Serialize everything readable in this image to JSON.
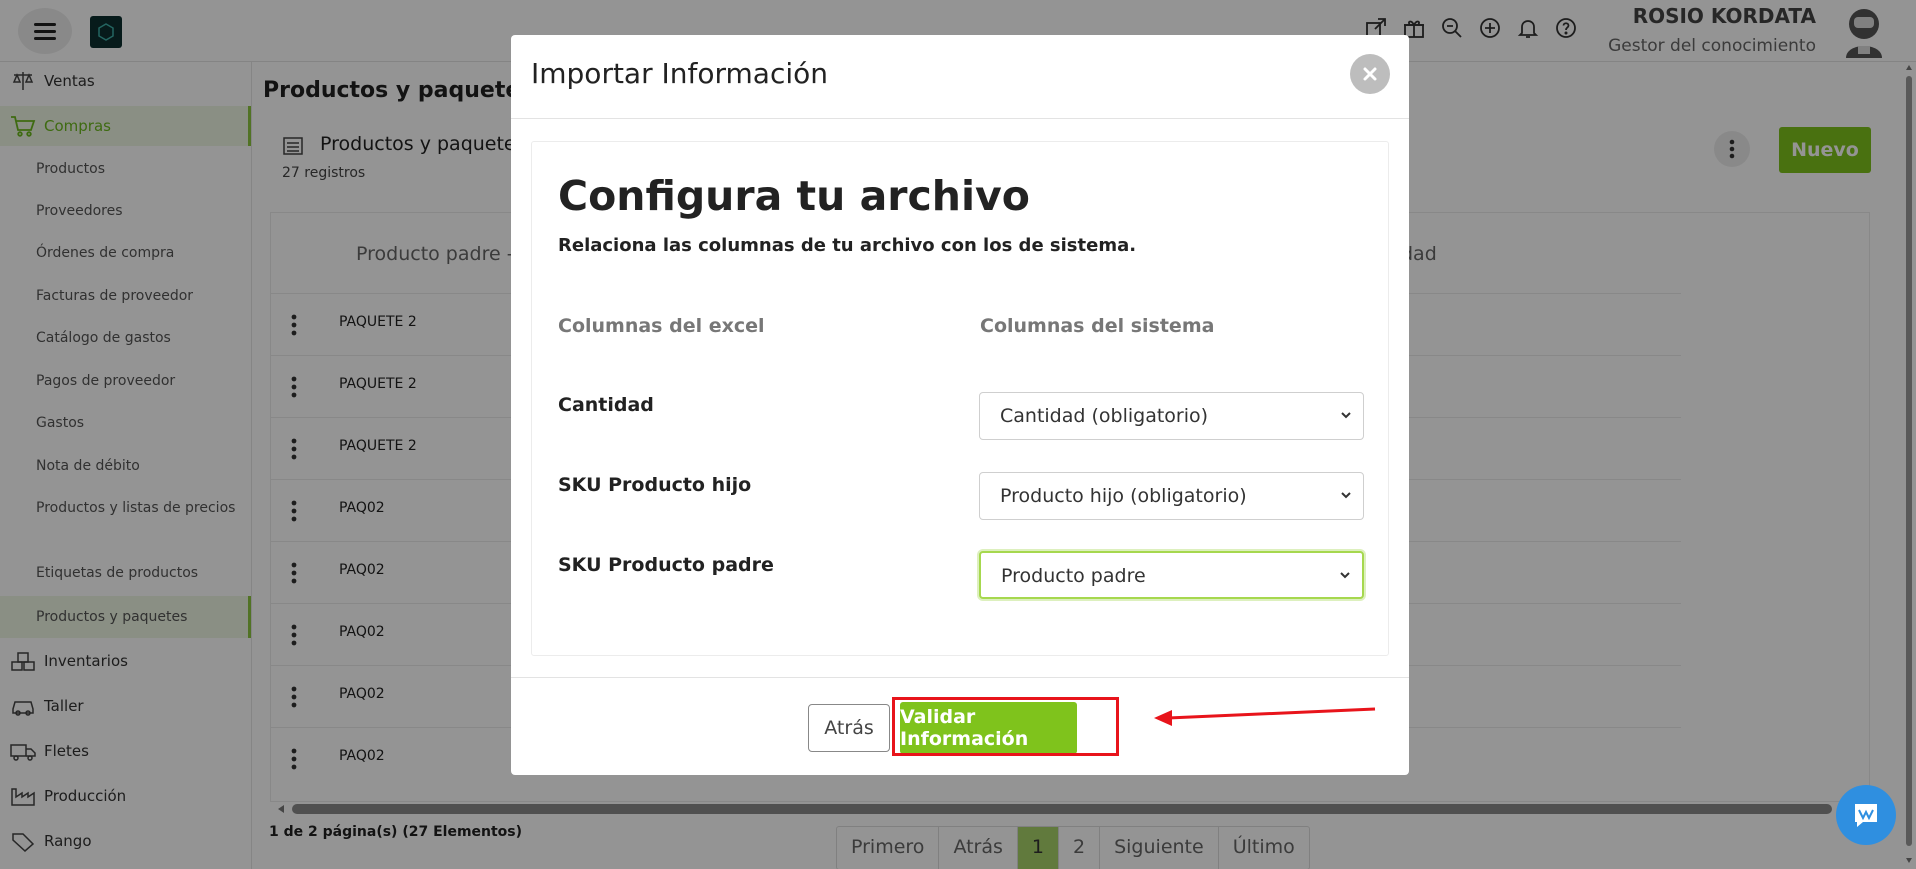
{
  "header": {
    "user_name": "ROSIO KORDATA",
    "user_role": "Gestor del conocimiento",
    "icons": [
      "external-link-icon",
      "gift-icon",
      "search-zoom-icon",
      "plus-circle-icon",
      "bell-icon",
      "help-icon"
    ]
  },
  "sidebar": {
    "sections": {
      "ventas": "Ventas",
      "compras": "Compras",
      "inventarios": "Inventarios",
      "taller": "Taller",
      "fletes": "Fletes",
      "produccion": "Producción",
      "cut": "Rango"
    },
    "items": [
      "Productos",
      "Proveedores",
      "Órdenes de compra",
      "Facturas de proveedor",
      "Catálogo de gastos",
      "Pagos de proveedor",
      "Gastos",
      "Nota de débito",
      "Productos y listas de precios",
      "Etiquetas de productos",
      "Productos y paquetes"
    ],
    "accent": "#8cc63f"
  },
  "main": {
    "title": "Productos y paquetes",
    "card_title": "Productos y paquetes",
    "records": "27 registros",
    "new_button": "Nuevo",
    "table": {
      "header_left": "Producto padre -",
      "header_right": "dad",
      "rows": [
        "PAQUETE 2",
        "PAQUETE 2",
        "PAQUETE 2",
        "PAQ02",
        "PAQ02",
        "PAQ02",
        "PAQ02",
        "PAQ02"
      ]
    },
    "pager": {
      "info": "1 de 2 página(s) (27 Elementos)",
      "first": "Primero",
      "prev": "Atrás",
      "pages": [
        "1",
        "2"
      ],
      "next": "Siguiente",
      "last": "Último",
      "current": "1"
    }
  },
  "modal": {
    "title": "Importar Información",
    "heading": "Configura tu archivo",
    "subheading": "Relaciona las columnas de tu archivo con los de sistema.",
    "col_excel": "Columnas del excel",
    "col_system": "Columnas del sistema",
    "mappings": [
      {
        "excel": "Cantidad",
        "system": "Cantidad (obligatorio)"
      },
      {
        "excel": "SKU Producto hijo",
        "system": "Producto hijo (obligatorio)"
      },
      {
        "excel": "SKU Producto padre",
        "system": "Producto padre"
      }
    ],
    "back_button": "Atrás",
    "validate_button": "Validar Información",
    "brand_green": "#7fc31c",
    "annotation_color": "#e8141b"
  }
}
